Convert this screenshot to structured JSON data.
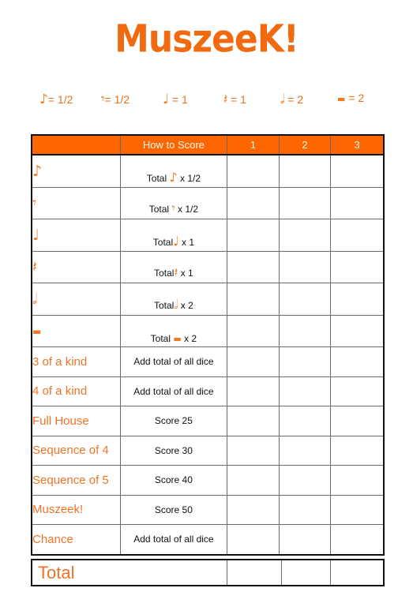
{
  "title": "MuszeeK!",
  "legend": [
    {
      "icon": "eighth-note-icon",
      "glyph": "♪",
      "text": "= 1/2"
    },
    {
      "icon": "eighth-rest-icon",
      "glyph": "𝄾",
      "text": "= 1/2"
    },
    {
      "icon": "quarter-note-icon",
      "glyph": "♩",
      "text": " = 1"
    },
    {
      "icon": "quarter-rest-icon",
      "glyph": "𝄽",
      "text": " = 1"
    },
    {
      "icon": "half-note-icon",
      "glyph": "𝅗𝅥",
      "text": " = 2"
    },
    {
      "icon": "half-rest-icon",
      "glyph": "▬",
      "text": " = 2"
    }
  ],
  "table": {
    "headers": [
      "",
      "How to Score",
      "1",
      "2",
      "3"
    ],
    "rows": [
      {
        "category": "",
        "category_glyph": "♪",
        "category_icon": "eighth-note-icon",
        "how_prefix": "Total ",
        "how_glyph": "♪",
        "how_suffix": " x 1/2"
      },
      {
        "category": "",
        "category_glyph": "𝄾",
        "category_icon": "eighth-rest-icon",
        "how_prefix": "Total ",
        "how_glyph": "𝄾",
        "how_suffix": " x 1/2"
      },
      {
        "category": "",
        "category_glyph": "♩",
        "category_icon": "quarter-note-icon",
        "how_prefix": "Total",
        "how_glyph": "♩",
        "how_suffix": " x 1"
      },
      {
        "category": "",
        "category_glyph": "𝄽",
        "category_icon": "quarter-rest-icon",
        "how_prefix": "Total",
        "how_glyph": "𝄽",
        "how_suffix": " x 1"
      },
      {
        "category": "",
        "category_glyph": "𝅗𝅥",
        "category_icon": "half-note-icon",
        "how_prefix": "Total",
        "how_glyph": "𝅗𝅥",
        "how_suffix": " x 2"
      },
      {
        "category": "",
        "category_glyph": "▬",
        "category_icon": "half-rest-icon",
        "how_prefix": "Total ",
        "how_glyph": "▬",
        "how_suffix": " x 2"
      },
      {
        "category": "3 of a kind",
        "how": "Add total of all dice"
      },
      {
        "category": "4 of a kind",
        "how": "Add total of all dice"
      },
      {
        "category": "Full House",
        "how": "Score 25"
      },
      {
        "category": "Sequence of 4",
        "how": "Score 30"
      },
      {
        "category": "Sequence of 5",
        "how": "Score 40"
      },
      {
        "category": "Muszeek!",
        "how": "Score 50"
      },
      {
        "category": "Chance",
        "how": "Add total of all dice"
      }
    ]
  },
  "total": {
    "label": "Total"
  },
  "colors": {
    "accent": "#ff6600",
    "text_accent": "#ef7426"
  }
}
